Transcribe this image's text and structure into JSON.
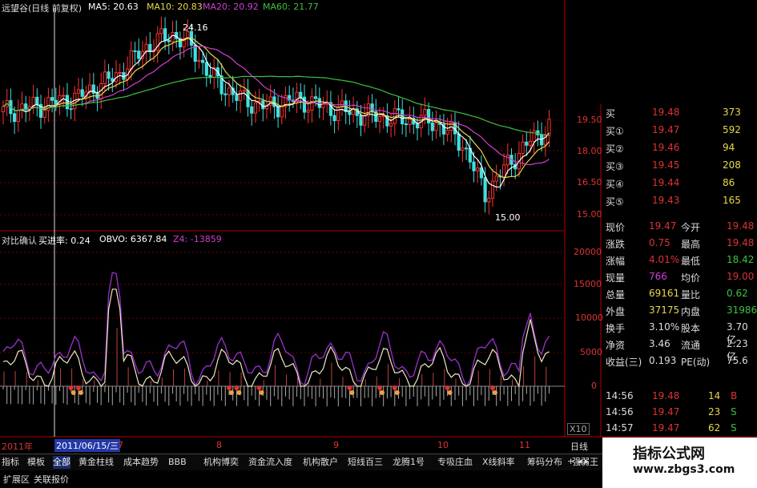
{
  "header": {
    "stock_label": "远望谷(日线 前复权)",
    "ma5": "MA5: 20.63",
    "ma10": "MA10: 20.83",
    "ma20": "MA20: 20.92",
    "ma60": "MA60: 21.77"
  },
  "price_annotations": {
    "high": "24.16",
    "low": "15.00"
  },
  "price_axis": [
    "19.50",
    "18.00",
    "16.50",
    "15.00"
  ],
  "indicator_bar": {
    "name": "对比确认",
    "buy_rate": "买进率: 0.24",
    "obvo": "OBVO: 6367.84",
    "z4": "Z4: -13859"
  },
  "indicator_axis": [
    "20000",
    "15000",
    "10000",
    "5000",
    "0"
  ],
  "axis_unit": "X10",
  "date_bar": {
    "year": "2011年",
    "cursor_date": "2011/06/15/三",
    "months": [
      "7",
      "8",
      "9",
      "10",
      "11"
    ]
  },
  "order_book": [
    {
      "label": "买①",
      "price": "19.47",
      "volume": "592"
    },
    {
      "label": "买②",
      "price": "19.46",
      "volume": "94"
    },
    {
      "label": "买③",
      "price": "19.45",
      "volume": "208"
    },
    {
      "label": "买④",
      "price": "19.44",
      "volume": "86"
    },
    {
      "label": "买⑤",
      "price": "19.43",
      "volume": "165"
    }
  ],
  "order_book_top": {
    "label": "买",
    "price": "19.48",
    "volume": "373"
  },
  "quote": [
    {
      "l1": "现价",
      "v1": "19.47",
      "l2": "今开",
      "v2": "19.48"
    },
    {
      "l1": "涨跌",
      "v1": "0.75",
      "l2": "最高",
      "v2": "19.48"
    },
    {
      "l1": "涨幅",
      "v1": "4.01%",
      "l2": "最低",
      "v2": "18.42"
    },
    {
      "l1": "现量",
      "v1": "766",
      "l2": "均价",
      "v2": "19.00"
    },
    {
      "l1": "总量",
      "v1": "69161",
      "l2": "量比",
      "v2": "0.62"
    },
    {
      "l1": "外盘",
      "v1": "37175",
      "l2": "内盘",
      "v2": "31986"
    },
    {
      "l1": "换手",
      "v1": "3.10%",
      "l2": "股本",
      "v2": "3.70亿"
    },
    {
      "l1": "净资",
      "v1": "3.46",
      "l2": "流通",
      "v2": "2.23亿"
    },
    {
      "l1": "收益(三)",
      "v1": "0.193",
      "l2": "PE(动)",
      "v2": "75.6"
    }
  ],
  "ticks": [
    {
      "time": "14:56",
      "price": "19.48",
      "vol": "14",
      "dir": "B"
    },
    {
      "time": "14:56",
      "price": "19.47",
      "vol": "23",
      "dir": "S"
    },
    {
      "time": "14:57",
      "price": "19.47",
      "vol": "62",
      "dir": "S"
    }
  ],
  "period_label": "日线",
  "tabs": [
    "指标",
    "模板",
    "全部",
    "黄金柱线",
    "成本趋势",
    "BBB",
    "机构博奕",
    "资金流入度",
    "机构散户",
    "短线百三",
    "龙腾1号",
    "专吸庄血",
    "X线斜率",
    "筹码分布",
    "强弱王"
  ],
  "bottom_tabs": [
    "扩展区",
    "关联报价"
  ],
  "watermark": {
    "line1": "指标公式网",
    "line2": "www.zbgs3.com"
  },
  "colors": {
    "up": "#ff3030",
    "down": "#40e0e0",
    "ma5": "#ffffff",
    "ma10": "#e8d84a",
    "ma20": "#d040d0",
    "ma60": "#40c040",
    "grid": "#8b0000"
  }
}
